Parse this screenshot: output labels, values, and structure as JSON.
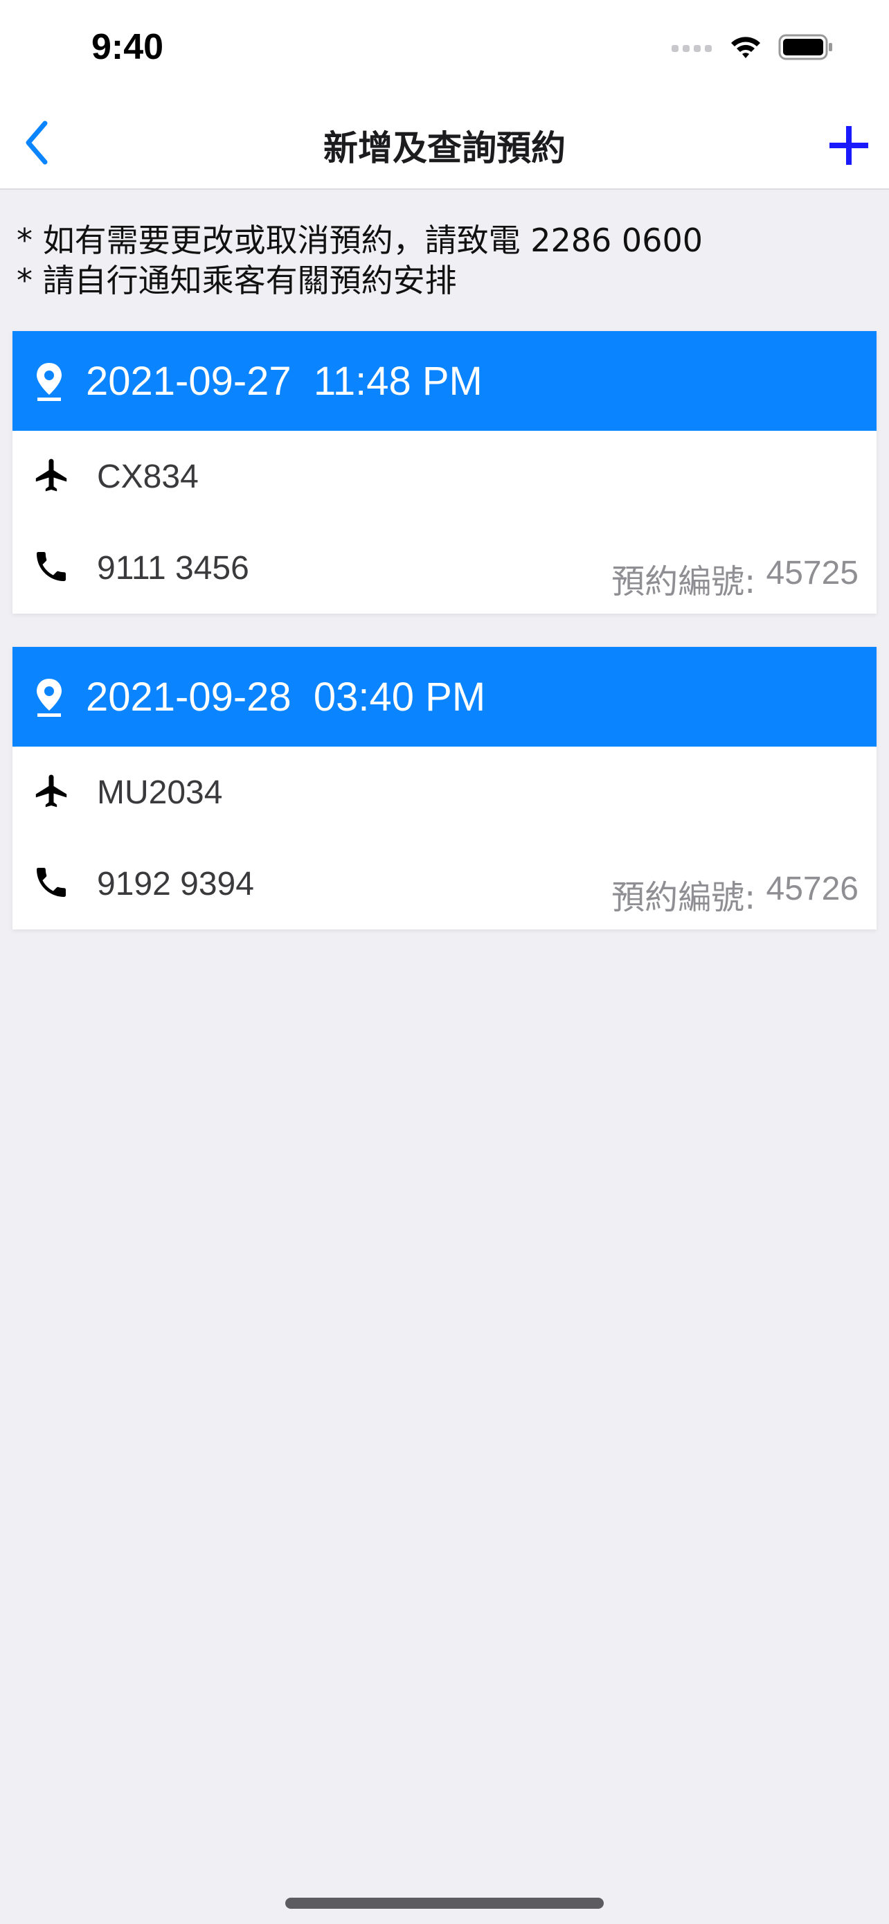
{
  "status_bar": {
    "time": "9:40",
    "icons": [
      "signal-icon",
      "wifi-icon",
      "battery-icon"
    ]
  },
  "nav": {
    "title": "新增及查詢預約",
    "back_icon": "chevron-left-icon",
    "add_icon": "plus-icon",
    "accent_color": "#0a84ff",
    "add_color": "#1a1aff"
  },
  "notes": [
    "* 如有需要更改或取消預約，請致電 2286 0600",
    "* 請自行通知乘客有關預約安排"
  ],
  "bookings": [
    {
      "datetime": "2021-09-27  11:48 PM",
      "flight": "CX834",
      "phone": "9111 3456",
      "booking_label": "預約編號: ",
      "booking_no": "45725"
    },
    {
      "datetime": "2021-09-28  03:40 PM",
      "flight": "MU2034",
      "phone": "9192 9394",
      "booking_label": "預約編號: ",
      "booking_no": "45726"
    }
  ],
  "colors": {
    "header_blue": "#0a84ff",
    "background": "#f0f0f4",
    "muted_text": "#8e8e93"
  }
}
